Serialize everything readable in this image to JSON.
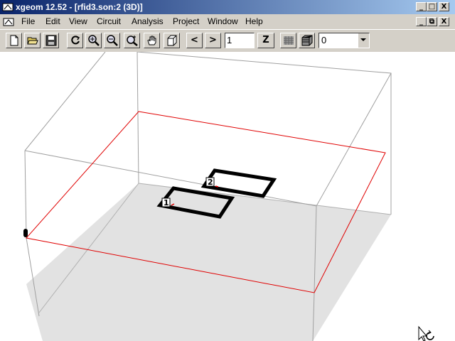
{
  "window": {
    "title": "xgeom 12.52 - [rfid3.son:2 (3D)]",
    "controls": {
      "minimize": "_",
      "maximize": "□",
      "close": "X",
      "restore": "⧉"
    }
  },
  "menu": [
    {
      "label": "File"
    },
    {
      "label": "Edit"
    },
    {
      "label": "View"
    },
    {
      "label": "Circuit"
    },
    {
      "label": "Analysis"
    },
    {
      "label": "Project"
    },
    {
      "label": "Window"
    },
    {
      "label": "Help"
    }
  ],
  "toolbar": {
    "prev_label": "<",
    "next_label": ">",
    "page_value": "1",
    "z_label": "Z",
    "level_value": "0"
  },
  "ports": [
    {
      "label": "1"
    },
    {
      "label": "2"
    }
  ],
  "colors": {
    "title_gradient_start": "#0a246a",
    "title_gradient_end": "#a6caf0",
    "box_edge": "#a0a0a0",
    "ground_plane": "#e2e2e2",
    "dielectric_boundary": "#e00000",
    "metal": "#000000"
  }
}
